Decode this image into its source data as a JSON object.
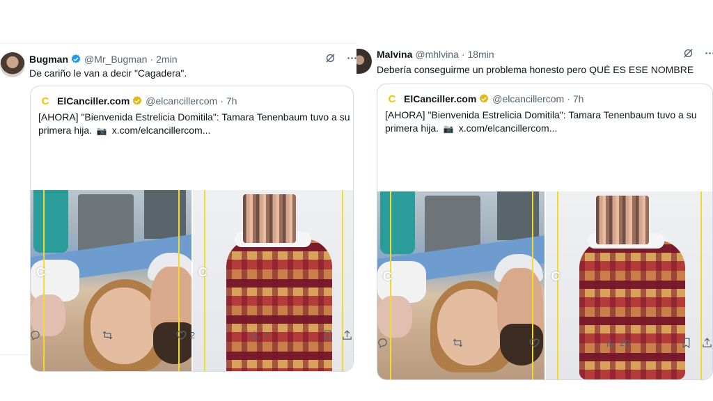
{
  "tweets": [
    {
      "author": {
        "name": "Bugman",
        "handle": "@Mr_Bugman",
        "time": "2min",
        "verified": true
      },
      "text": "De cariño le van a decir \"Cagadera\".",
      "quote": {
        "author": {
          "name": "ElCanciller.com",
          "handle": "@elcancillercom",
          "time": "7h",
          "logo": "C"
        },
        "text_before": "[AHORA] \"Bienvenida Estrelicia Domitila\": Tamara Tenenbaum tuvo a su primera hija.",
        "text_link": "x.com/elcancillercom..."
      },
      "media_watermark": "C",
      "stats": {
        "replies": "",
        "reposts": "",
        "likes": "2",
        "views": "7"
      }
    },
    {
      "author": {
        "name": "Malvina",
        "handle": "@mhlvina",
        "time": "18min",
        "verified": false
      },
      "text": "Debería conseguirme un problema honesto pero QUÉ ES ESE NOMBRE",
      "quote": {
        "author": {
          "name": "ElCanciller.com",
          "handle": "@elcancillercom",
          "time": "7h",
          "logo": "C"
        },
        "text_before": "[AHORA] \"Bienvenida Estrelicia Domitila\": Tamara Tenenbaum tuvo a su primera hija.",
        "text_link": "x.com/elcancillercom..."
      },
      "media_watermark": "C",
      "stats": {
        "replies": "",
        "reposts": "",
        "likes": "",
        "views": "20"
      }
    }
  ],
  "colors": {
    "accent": "#1d9bf0",
    "gold_badge": "#f2c200",
    "muted": "#536471",
    "border": "#cfd9de"
  },
  "icons": [
    "verified-icon",
    "grok-icon",
    "more-icon",
    "reply-icon",
    "repost-icon",
    "like-icon",
    "views-icon",
    "bookmark-icon",
    "share-icon",
    "camera-icon"
  ]
}
